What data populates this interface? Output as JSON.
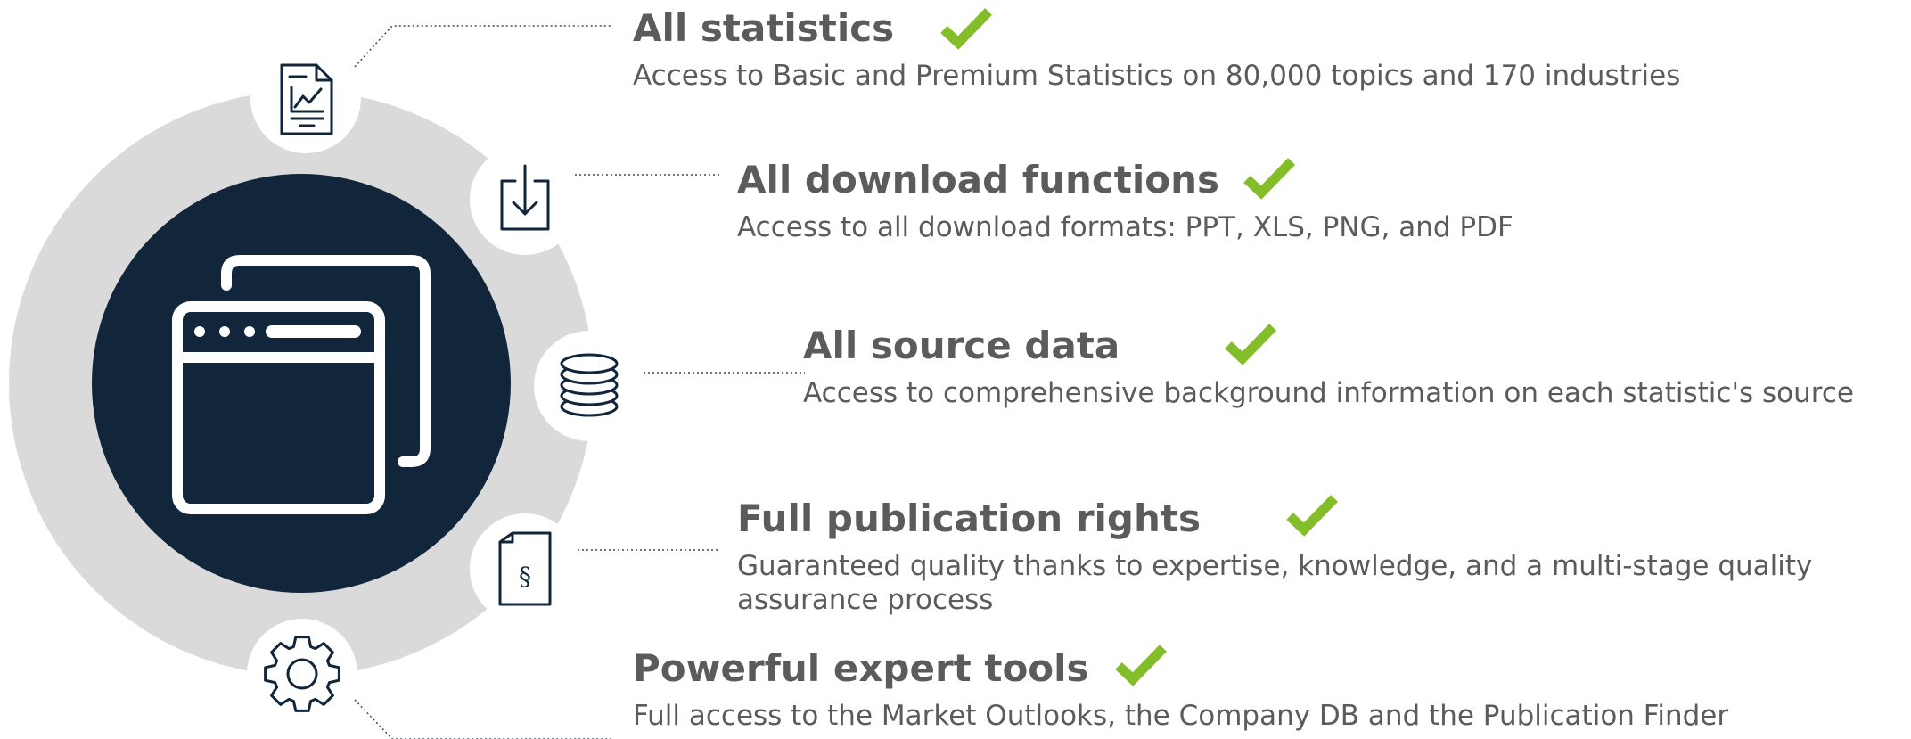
{
  "features": [
    {
      "id": "statistics",
      "title": "All statistics",
      "description": "Access to Basic and Premium Statistics on 80,000 topics and 170 industries",
      "icon": "chart-document-icon"
    },
    {
      "id": "download",
      "title": "All download functions",
      "description": "Access to all download formats: PPT, XLS, PNG, and PDF",
      "icon": "download-icon"
    },
    {
      "id": "source",
      "title": "All source data",
      "description": "Access to comprehensive background information on each statistic's source",
      "icon": "database-icon"
    },
    {
      "id": "publication",
      "title": "Full publication rights",
      "description": "Guaranteed quality thanks to expertise, knowledge, and a multi-stage quality assurance process",
      "icon": "legal-document-icon"
    },
    {
      "id": "tools",
      "title": "Powerful expert tools",
      "description": "Full access to the Market Outlooks, the Company DB and the Publication Finder",
      "icon": "gear-icon"
    }
  ],
  "center_icon": "browser-windows-icon",
  "colors": {
    "navy": "#11253b",
    "ring": "#dadada",
    "check": "#84bd2a",
    "text": "#5b5b5b",
    "connector": "#3a4a5c"
  }
}
